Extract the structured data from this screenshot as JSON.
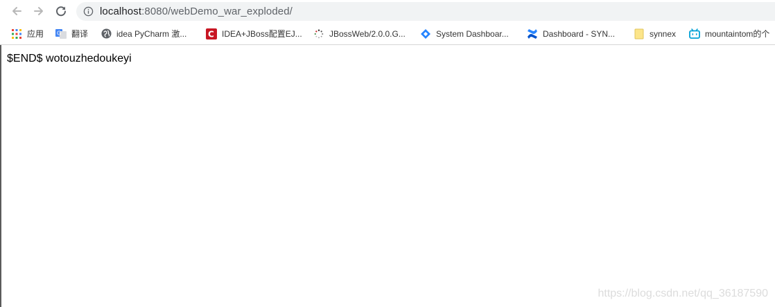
{
  "address_bar": {
    "host": "localhost",
    "rest": ":8080/webDemo_war_exploded/"
  },
  "bookmarks": [
    {
      "label": "应用",
      "icon": "apps-grid-icon"
    },
    {
      "label": "翻译",
      "icon": "google-translate-icon"
    },
    {
      "label": "idea PyCharm 激...",
      "icon": "globe-icon"
    },
    {
      "label": "IDEA+JBoss配置EJ...",
      "icon": "csdn-icon"
    },
    {
      "label": "JBossWeb/2.0.0.G...",
      "icon": "loading-spinner-icon"
    },
    {
      "label": "System Dashboar...",
      "icon": "jira-icon"
    },
    {
      "label": "Dashboard - SYN...",
      "icon": "confluence-icon"
    },
    {
      "label": "synnex",
      "icon": "folder-icon"
    },
    {
      "label": "mountaintom的个",
      "icon": "bilibili-icon"
    }
  ],
  "page": {
    "body_text": "$END$ wotouzhedoukeyi"
  },
  "watermark": "https://blog.csdn.net/qq_36187590",
  "colors": {
    "omnibox_bg": "#f1f3f4",
    "csdn_red": "#c81623",
    "jira_blue": "#2684ff",
    "confluence_blue": "#0052cc",
    "bilibili_cyan": "#00a1d6"
  }
}
